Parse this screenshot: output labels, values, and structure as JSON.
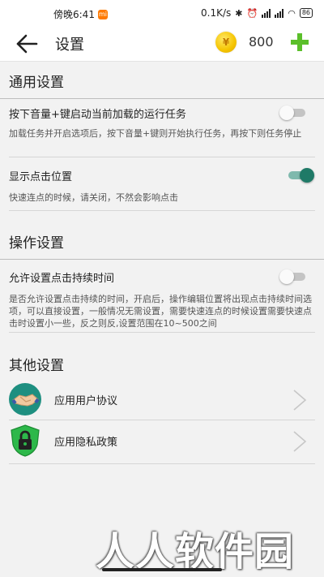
{
  "status_bar": {
    "time": "傍晚6:41",
    "net_speed": "0.1K/s",
    "battery": "86"
  },
  "app_bar": {
    "title": "设置",
    "coin_symbol": "¥",
    "coin_count": "800"
  },
  "sections": {
    "general": {
      "header": "通用设置",
      "volume_key": {
        "title": "按下音量+键启动当前加载的运行任务",
        "desc": "加载任务并开启选项后，按下音量+键则开始执行任务，再按下则任务停止",
        "enabled": false
      },
      "show_click": {
        "title": "显示点击位置",
        "desc": "快速连点的时候，请关闭，不然会影响点击",
        "enabled": true
      }
    },
    "operation": {
      "header": "操作设置",
      "click_duration": {
        "title": "允许设置点击持续时间",
        "desc": "是否允许设置点击持续的时间，开启后，操作编辑位置将出现点击持续时间选项，可以直接设置，一般情况无需设置，需要快速连点的时候设置需要快速点击时设置小一些，反之则反,设置范围在10~500之间",
        "enabled": false
      }
    },
    "other": {
      "header": "其他设置",
      "items": [
        {
          "label": "应用用户协议",
          "icon": "handshake-icon"
        },
        {
          "label": "应用隐私政策",
          "icon": "lock-shield-icon"
        }
      ]
    }
  },
  "watermark": "人人软件园",
  "colors": {
    "accent_green": "#5bbf2a",
    "toggle_on": "#1f7a67",
    "coin": "#f5c400"
  }
}
